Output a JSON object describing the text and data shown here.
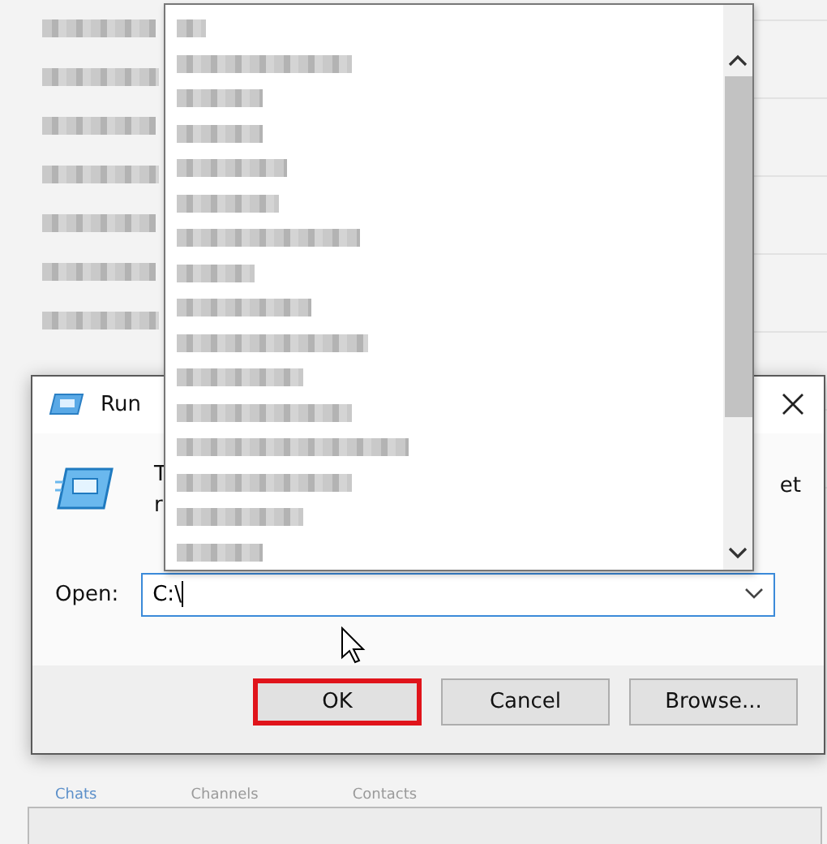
{
  "background": {
    "list_items": [
      {
        "kind": "redacted"
      },
      {
        "kind": "redacted"
      },
      {
        "kind": "redacted"
      },
      {
        "kind": "redacted"
      },
      {
        "kind": "redacted"
      },
      {
        "kind": "redacted"
      },
      {
        "kind": "redacted"
      }
    ],
    "tabs": [
      {
        "label": "Chats",
        "selected": true
      },
      {
        "label": "Channels",
        "selected": false
      },
      {
        "label": "Contacts",
        "selected": false
      }
    ]
  },
  "dialog": {
    "title": "Run",
    "description_left": [
      "T",
      "r"
    ],
    "description_right": "et",
    "open_label": "Open:",
    "open_value": "C:\\",
    "buttons": [
      {
        "label": "OK",
        "highlighted": true
      },
      {
        "label": "Cancel",
        "highlighted": false
      },
      {
        "label": "Browse...",
        "highlighted": false
      }
    ]
  },
  "dropdown": {
    "items": [
      {
        "kind": "redacted"
      },
      {
        "kind": "redacted"
      },
      {
        "kind": "redacted"
      },
      {
        "kind": "redacted"
      },
      {
        "kind": "redacted"
      },
      {
        "kind": "redacted"
      },
      {
        "kind": "redacted"
      },
      {
        "kind": "redacted"
      },
      {
        "kind": "redacted"
      },
      {
        "kind": "redacted"
      },
      {
        "kind": "redacted"
      },
      {
        "kind": "redacted"
      },
      {
        "kind": "redacted"
      },
      {
        "kind": "redacted"
      },
      {
        "kind": "redacted"
      },
      {
        "kind": "redacted"
      }
    ]
  }
}
